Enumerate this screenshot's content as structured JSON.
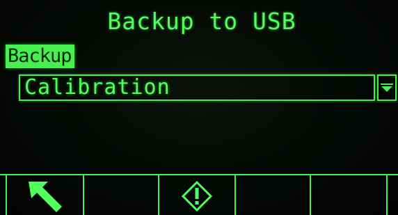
{
  "screen": {
    "title": "Backup to USB",
    "field_label": "Backup",
    "dropdown": {
      "selected_value": "Calibration",
      "arrow_icon": "triangle-down-icon"
    },
    "softkeys": [
      {
        "icon": "escape-arrow-icon"
      },
      {
        "icon": ""
      },
      {
        "icon": "start-icon"
      },
      {
        "icon": ""
      },
      {
        "icon": ""
      },
      {
        "icon": ""
      }
    ]
  },
  "colors": {
    "foreground": "#50ff5c",
    "background": "#040804",
    "highlight_text": "#062406"
  }
}
